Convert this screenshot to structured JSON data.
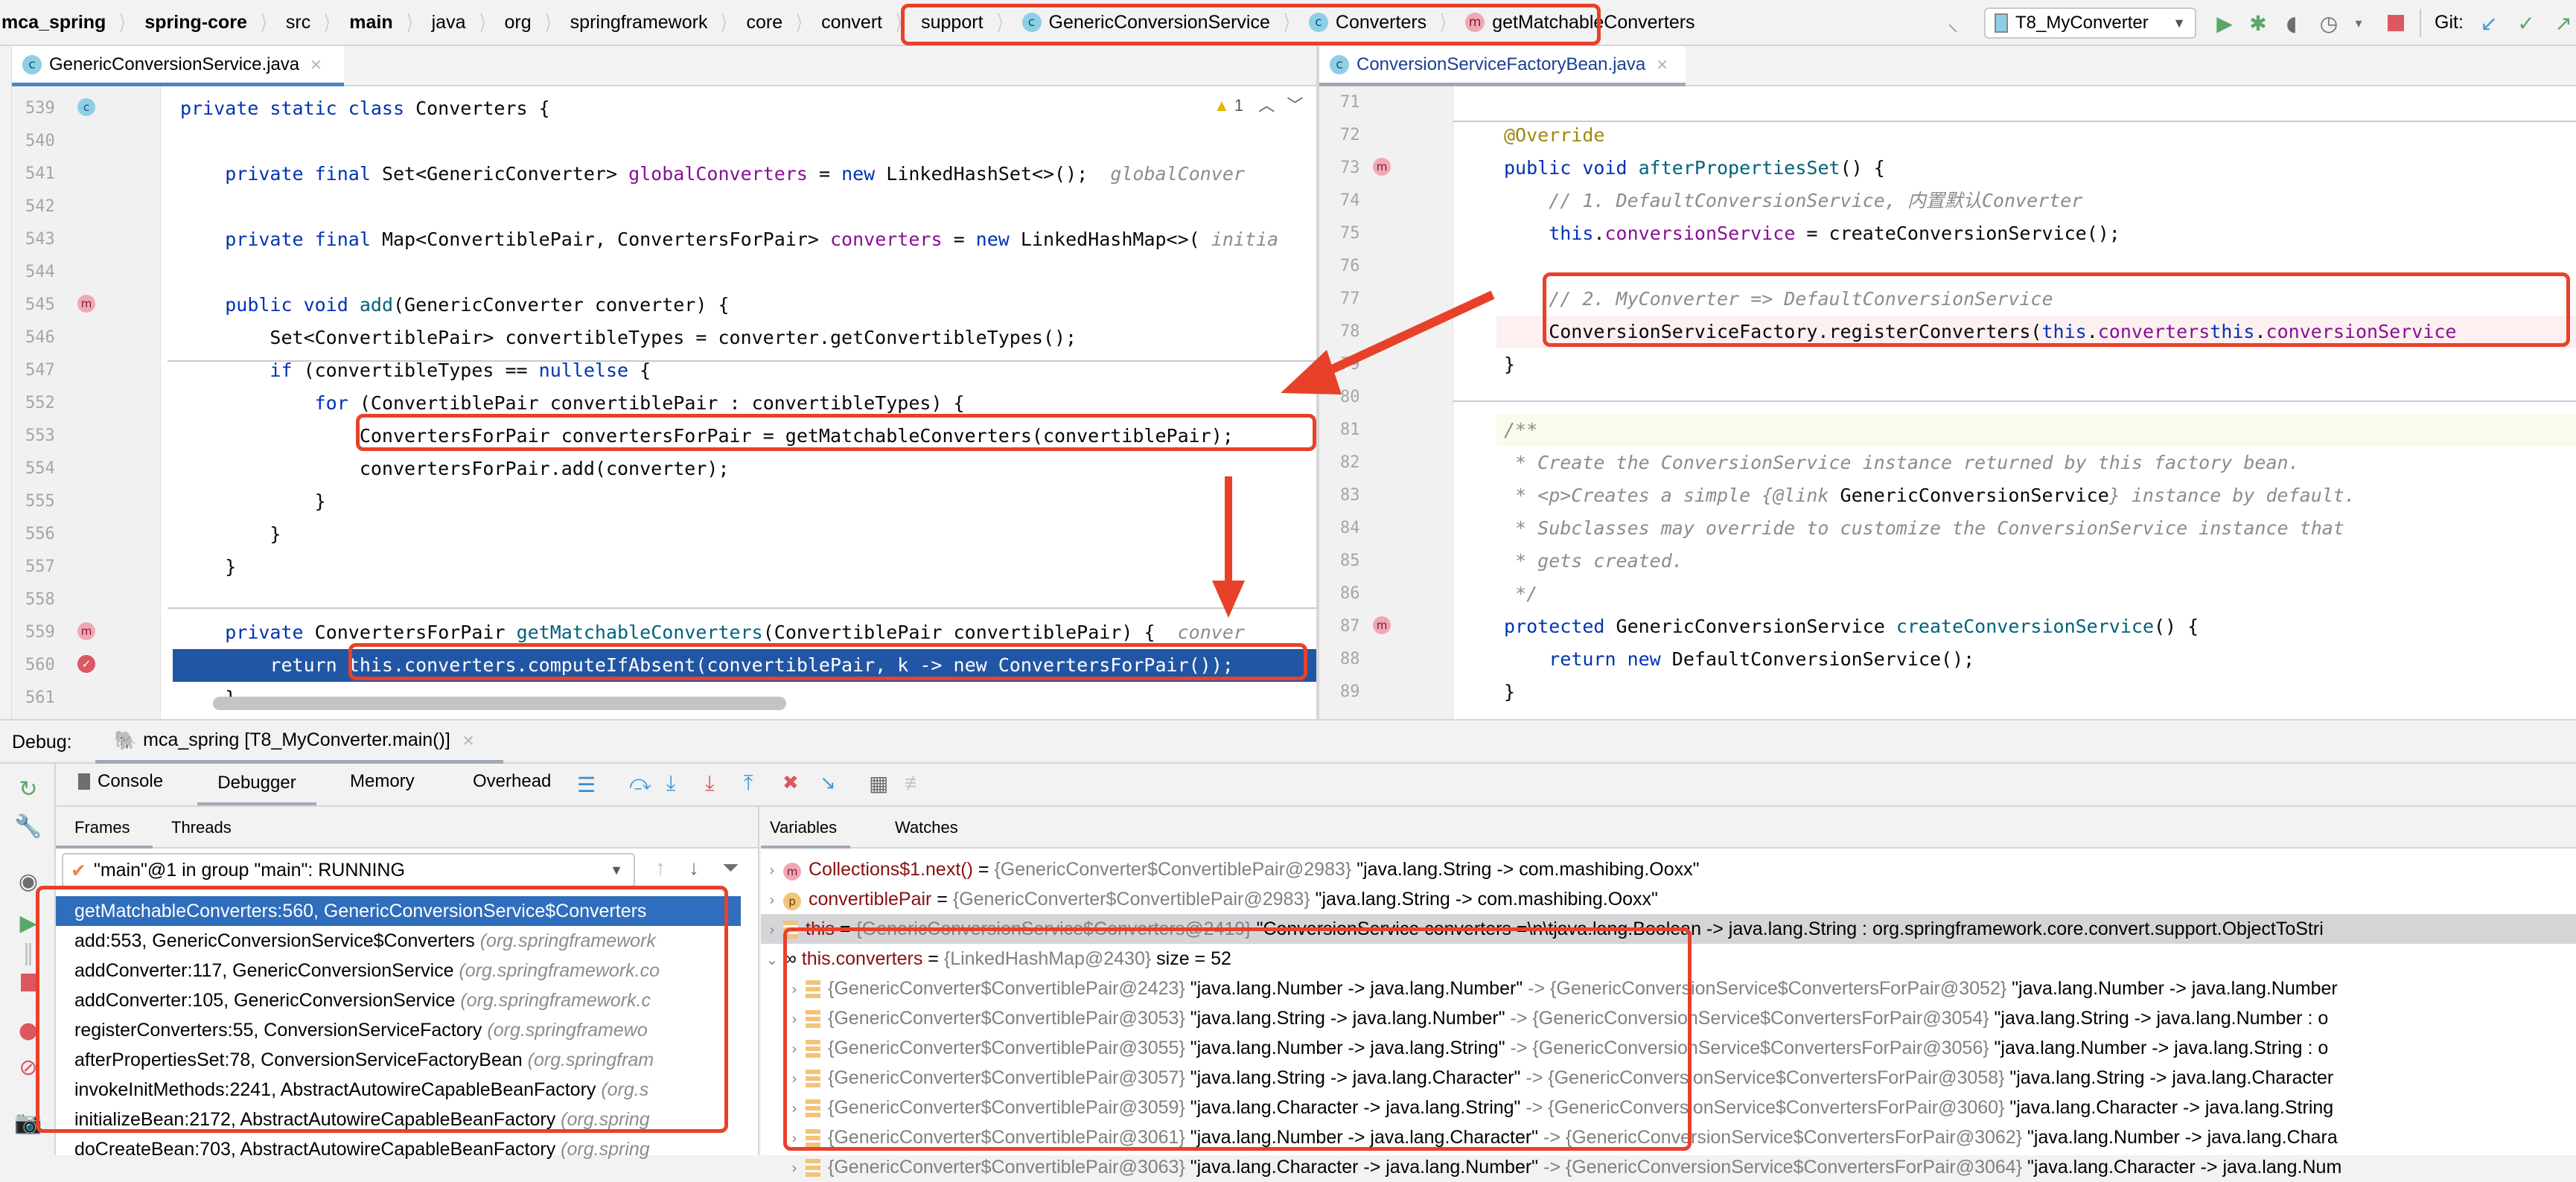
{
  "breadcrumb": [
    {
      "label": "mca_spring",
      "bold": true
    },
    {
      "label": "spring-core",
      "bold": true
    },
    {
      "label": "src",
      "bold": false
    },
    {
      "label": "main",
      "bold": true
    },
    {
      "label": "java",
      "bold": false
    },
    {
      "label": "org",
      "bold": false
    },
    {
      "label": "springframework",
      "bold": false
    },
    {
      "label": "core",
      "bold": false
    },
    {
      "label": "convert",
      "bold": false
    },
    {
      "label": "support",
      "bold": false
    }
  ],
  "breadcrumb_symbols": [
    {
      "icon": "c",
      "label": "GenericConversionService"
    },
    {
      "icon": "c",
      "label": "Converters"
    },
    {
      "icon": "m",
      "label": "getMatchableConverters"
    }
  ],
  "toolbar": {
    "run_config": "T8_MyConverter",
    "git_label": "Git:",
    "icons": [
      "build-hammer-icon",
      "run-icon",
      "debug-icon",
      "coverage-icon",
      "profile-icon",
      "stop-icon",
      "git-update-icon",
      "git-commit-icon",
      "git-push-icon"
    ]
  },
  "left_editor": {
    "tab": "GenericConversionService.java",
    "warning_count": "1",
    "lines": [
      {
        "n": "539",
        "segs": [
          [
            "kw",
            "private static class "
          ],
          [
            "",
            "Converters {"
          ]
        ]
      },
      {
        "n": "540",
        "segs": []
      },
      {
        "n": "541",
        "segs": [
          [
            "",
            "    "
          ],
          [
            "kw",
            "private final "
          ],
          [
            "",
            "Set<GenericConverter> "
          ],
          [
            "fld",
            "globalConverters"
          ],
          [
            "",
            " = "
          ],
          [
            "kw",
            "new "
          ],
          [
            "",
            "LinkedHashSet<>();  "
          ],
          [
            "hint",
            "globalConver"
          ]
        ]
      },
      {
        "n": "542",
        "segs": []
      },
      {
        "n": "543",
        "segs": [
          [
            "",
            "    "
          ],
          [
            "kw",
            "private final "
          ],
          [
            "",
            "Map<ConvertiblePair, ConvertersForPair> "
          ],
          [
            "fld",
            "converters"
          ],
          [
            "",
            " = "
          ],
          [
            "kw",
            "new "
          ],
          [
            "",
            "LinkedHashMap<>( "
          ],
          [
            "hint",
            "initia"
          ]
        ]
      },
      {
        "n": "544",
        "segs": []
      },
      {
        "n": "545",
        "segs": [
          [
            "",
            "    "
          ],
          [
            "kw",
            "public void "
          ],
          [
            "fn",
            "add"
          ],
          [
            "",
            "(GenericConverter converter) {"
          ]
        ]
      },
      {
        "n": "546",
        "segs": [
          [
            "",
            "        Set<ConvertiblePair> convertibleTypes = converter.getConvertibleTypes();"
          ]
        ]
      },
      {
        "n": "547",
        "segs": [
          [
            "",
            "        "
          ],
          [
            "kw",
            "if "
          ],
          [
            "",
            "(convertibleTypes == "
          ],
          [
            "kw",
            "null"
          ],
          [
            ") {...} "
          ],
          [
            "kw",
            "else "
          ],
          [
            "",
            "{"
          ]
        ]
      },
      {
        "n": "552",
        "segs": [
          [
            "",
            "            "
          ],
          [
            "kw",
            "for "
          ],
          [
            "",
            "(ConvertiblePair convertiblePair : convertibleTypes) {"
          ]
        ]
      },
      {
        "n": "553",
        "segs": [
          [
            "",
            "                ConvertersForPair convertersForPair = getMatchableConverters(convertiblePair);"
          ]
        ]
      },
      {
        "n": "554",
        "segs": [
          [
            "",
            "                convertersForPair.add(converter);"
          ]
        ]
      },
      {
        "n": "555",
        "segs": [
          [
            "",
            "            }"
          ]
        ]
      },
      {
        "n": "556",
        "segs": [
          [
            "",
            "        }"
          ]
        ]
      },
      {
        "n": "557",
        "segs": [
          [
            "",
            "    }"
          ]
        ]
      },
      {
        "n": "558",
        "segs": []
      },
      {
        "n": "559",
        "segs": [
          [
            "",
            "    "
          ],
          [
            "kw",
            "private "
          ],
          [
            "",
            "ConvertersForPair "
          ],
          [
            "fn",
            "getMatchableConverters"
          ],
          [
            "",
            "(ConvertiblePair convertiblePair) {  "
          ],
          [
            "hint",
            "conver"
          ]
        ]
      },
      {
        "n": "560",
        "segs": [
          [
            "",
            "        return this.converters.computeIfAbsent(convertiblePair, k -> new ConvertersForPair());"
          ]
        ]
      },
      {
        "n": "561",
        "segs": [
          [
            "",
            "    }"
          ]
        ]
      }
    ]
  },
  "right_editor": {
    "tab": "ConversionServiceFactoryBean.java",
    "lines": [
      {
        "n": "71",
        "segs": []
      },
      {
        "n": "72",
        "segs": [
          [
            "ann",
            "@Override"
          ]
        ]
      },
      {
        "n": "73",
        "segs": [
          [
            "kw",
            "public void "
          ],
          [
            "fn",
            "afterPropertiesSet"
          ],
          [
            "",
            "() {"
          ]
        ]
      },
      {
        "n": "74",
        "segs": [
          [
            "",
            "    "
          ],
          [
            "cm",
            "// 1. DefaultConversionService, 内置默认Converter"
          ]
        ]
      },
      {
        "n": "75",
        "segs": [
          [
            "",
            "    "
          ],
          [
            "kw",
            "this"
          ],
          [
            "",
            "."
          ],
          [
            "fld",
            "conversionService"
          ],
          [
            "",
            " = createConversionService();"
          ]
        ]
      },
      {
        "n": "76",
        "segs": []
      },
      {
        "n": "77",
        "segs": [
          [
            "",
            "    "
          ],
          [
            "cm",
            "// 2. MyConverter => DefaultConversionService"
          ]
        ]
      },
      {
        "n": "78",
        "segs": [
          [
            "",
            "    ConversionServiceFactory.registerConverters("
          ],
          [
            "kw",
            "this"
          ],
          [
            "",
            "."
          ],
          [
            "fld",
            "converters"
          ],
          [
            ", "
          ],
          [
            "kw",
            "this"
          ],
          [
            "",
            "."
          ],
          [
            "fld",
            "conversionService"
          ],
          [
            ");"
          ]
        ]
      },
      {
        "n": "79",
        "segs": [
          [
            "",
            "}"
          ]
        ]
      },
      {
        "n": "80",
        "segs": []
      },
      {
        "n": "81",
        "segs": [
          [
            "cm",
            "/**"
          ]
        ]
      },
      {
        "n": "82",
        "segs": [
          [
            "cm",
            " * Create the ConversionService instance returned by this factory bean."
          ]
        ]
      },
      {
        "n": "83",
        "segs": [
          [
            "cm",
            " * <p>Creates a simple {@link "
          ],
          [
            "",
            "GenericConversionService"
          ],
          [
            "cm",
            "} instance by default."
          ]
        ]
      },
      {
        "n": "84",
        "segs": [
          [
            "cm",
            " * Subclasses may override to customize the ConversionService instance that"
          ]
        ]
      },
      {
        "n": "85",
        "segs": [
          [
            "cm",
            " * gets created."
          ]
        ]
      },
      {
        "n": "86",
        "segs": [
          [
            "cm",
            " */"
          ]
        ]
      },
      {
        "n": "87",
        "segs": [
          [
            "kw",
            "protected "
          ],
          [
            "",
            "GenericConversionService "
          ],
          [
            "fn",
            "createConversionService"
          ],
          [
            "",
            "() {"
          ]
        ]
      },
      {
        "n": "88",
        "segs": [
          [
            "",
            "    "
          ],
          [
            "kw",
            "return new "
          ],
          [
            "",
            "DefaultConversionService();"
          ]
        ]
      },
      {
        "n": "89",
        "segs": [
          [
            "",
            "}"
          ]
        ]
      }
    ]
  },
  "debug": {
    "label": "Debug:",
    "session": "mca_spring [T8_MyConverter.main()]",
    "tabs": [
      "Console",
      "Debugger",
      "Memory",
      "Overhead"
    ],
    "active_tab": "Debugger",
    "frame_tabs": [
      "Frames",
      "Threads"
    ],
    "thread_select": "\"main\"@1 in group \"main\": RUNNING",
    "frames": [
      {
        "text": "getMatchableConverters:560, GenericConversionService$Converters",
        "pkg": ""
      },
      {
        "text": "add:553, GenericConversionService$Converters",
        "pkg": "(org.springframework"
      },
      {
        "text": "addConverter:117, GenericConversionService",
        "pkg": "(org.springframework.co"
      },
      {
        "text": "addConverter:105, GenericConversionService",
        "pkg": "(org.springframework.c"
      },
      {
        "text": "registerConverters:55, ConversionServiceFactory",
        "pkg": "(org.springframewo"
      },
      {
        "text": "afterPropertiesSet:78, ConversionServiceFactoryBean",
        "pkg": "(org.springfram"
      },
      {
        "text": "invokeInitMethods:2241, AbstractAutowireCapableBeanFactory",
        "pkg": "(org.s"
      },
      {
        "text": "initializeBean:2172, AbstractAutowireCapableBeanFactory",
        "pkg": "(org.spring"
      },
      {
        "text": "doCreateBean:703, AbstractAutowireCapableBeanFactory",
        "pkg": "(org.spring"
      }
    ],
    "var_tabs": [
      "Variables",
      "Watches"
    ],
    "variables": [
      {
        "icon": "m",
        "name": "Collections$1.next()",
        "ref": "{GenericConverter$ConvertiblePair@2983}",
        "value": "\"java.lang.String -> com.mashibing.Ooxx\""
      },
      {
        "icon": "p",
        "name": "convertiblePair",
        "ref": "{GenericConverter$ConvertiblePair@2983}",
        "value": "\"java.lang.String -> com.mashibing.Ooxx\""
      },
      {
        "icon": "f",
        "name": "this",
        "ref": "{GenericConversionService$Converters@2419}",
        "value": "\"ConversionService converters =\\n\\tjava.lang.Boolean -> java.lang.String : org.springframework.core.convert.support.ObjectToStri"
      }
    ],
    "converters_var": {
      "name": "this.converters",
      "ref": "{LinkedHashMap@2430}",
      "size": "size = 52"
    },
    "map_entries": [
      {
        "key": "{GenericConverter$ConvertiblePair@2423}",
        "key_str": "\"java.lang.Number -> java.lang.Number\"",
        "val": "{GenericConversionService$ConvertersForPair@3052}",
        "val_str": "\"java.lang.Number -> java.lang.Number"
      },
      {
        "key": "{GenericConverter$ConvertiblePair@3053}",
        "key_str": "\"java.lang.String -> java.lang.Number\"",
        "val": "{GenericConversionService$ConvertersForPair@3054}",
        "val_str": "\"java.lang.String -> java.lang.Number : o"
      },
      {
        "key": "{GenericConverter$ConvertiblePair@3055}",
        "key_str": "\"java.lang.Number -> java.lang.String\"",
        "val": "{GenericConversionService$ConvertersForPair@3056}",
        "val_str": "\"java.lang.Number -> java.lang.String : o"
      },
      {
        "key": "{GenericConverter$ConvertiblePair@3057}",
        "key_str": "\"java.lang.String -> java.lang.Character\"",
        "val": "{GenericConversionService$ConvertersForPair@3058}",
        "val_str": "\"java.lang.String -> java.lang.Character"
      },
      {
        "key": "{GenericConverter$ConvertiblePair@3059}",
        "key_str": "\"java.lang.Character -> java.lang.String\"",
        "val": "{GenericConversionService$ConvertersForPair@3060}",
        "val_str": "\"java.lang.Character -> java.lang.String"
      },
      {
        "key": "{GenericConverter$ConvertiblePair@3061}",
        "key_str": "\"java.lang.Number -> java.lang.Character\"",
        "val": "{GenericConversionService$ConvertersForPair@3062}",
        "val_str": "\"java.lang.Number -> java.lang.Chara"
      },
      {
        "key": "{GenericConverter$ConvertiblePair@3063}",
        "key_str": "\"java.lang.Character -> java.lang.Number\"",
        "val": "{GenericConversionService$ConvertersForPair@3064}",
        "val_str": "\"java.lang.Character -> java.lang.Num"
      }
    ]
  },
  "colors": {
    "annotation_red": "#e8412a",
    "selection_blue": "#2156a5",
    "frame_selected": "#2f6dbd"
  }
}
